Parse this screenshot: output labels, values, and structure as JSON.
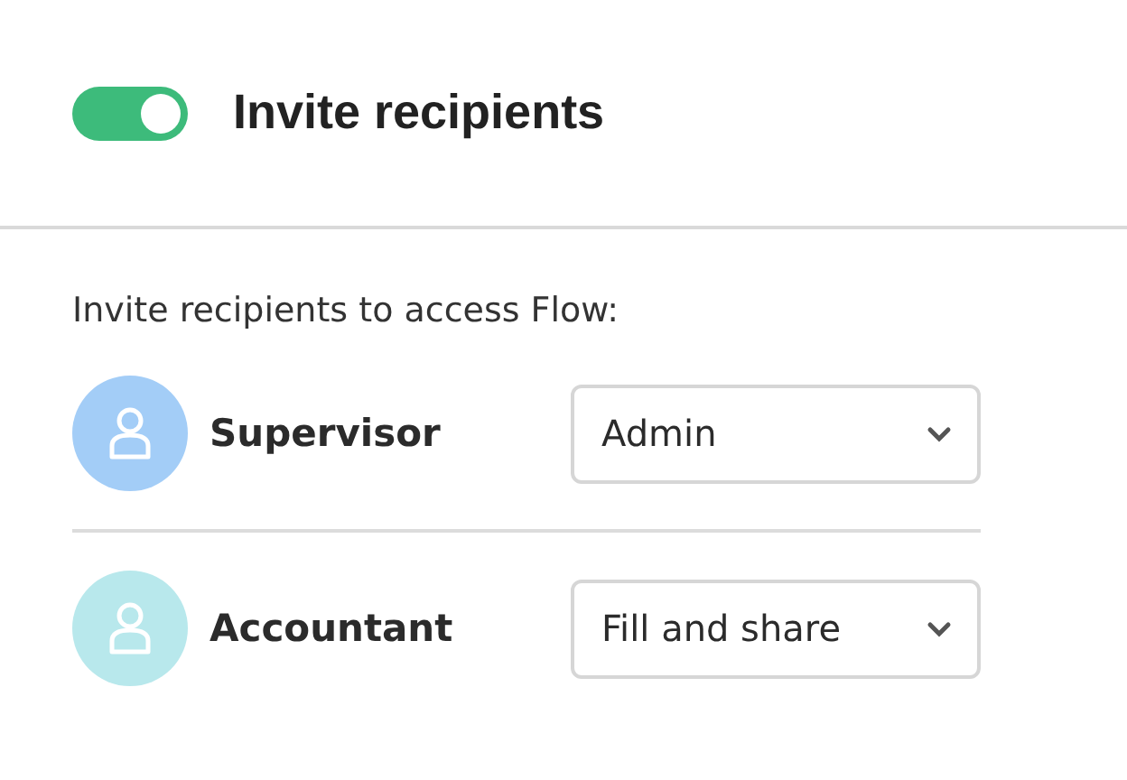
{
  "header": {
    "toggle_on": true,
    "title": "Invite recipients"
  },
  "intro": "Invite recipients to access Flow:",
  "recipients": [
    {
      "name": "Supervisor",
      "color": "#a3cdf7",
      "role": "Admin"
    },
    {
      "name": "Accountant",
      "color": "#b8e8ec",
      "role": "Fill and share"
    }
  ]
}
